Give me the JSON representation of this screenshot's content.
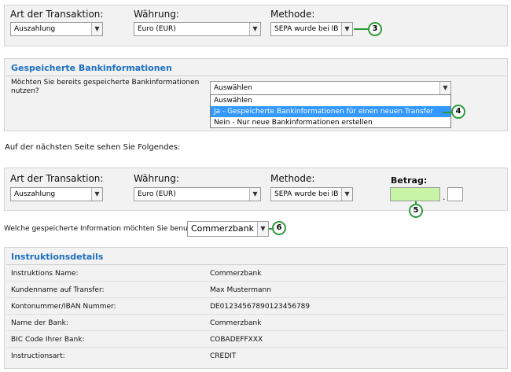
{
  "form1": {
    "type_label": "Art der Transaktion:",
    "type_value": "Auszahlung",
    "currency_label": "Währung:",
    "currency_value": "Euro (EUR)",
    "method_label": "Methode:",
    "method_value": "SEPA wurde bei IB ver",
    "badge": "3"
  },
  "bank_section": {
    "title": "Gespeicherte Bankinformationen",
    "question": "Möchten Sie bereits gespeicherte Bankinformationen nutzen?",
    "select_value": "Auswählen",
    "options": [
      "Auswählen",
      "Ja - Gespeicherte Bankinformationen für einen neuen Transfer nutzen",
      "Nein - Nur neue Bankinformationen erstellen"
    ],
    "badge": "4"
  },
  "next_page_text": "Auf der nächsten Seite sehen Sie Folgendes:",
  "form2": {
    "type_label": "Art der Transaktion:",
    "type_value": "Auszahlung",
    "currency_label": "Währung:",
    "currency_value": "Euro (EUR)",
    "method_label": "Methode:",
    "method_value": "SEPA wurde bei IB ver",
    "amount_label": "Betrag:",
    "amount_sep": ".",
    "badge": "5"
  },
  "saved_info": {
    "question": "Welche gespeicherte Information möchten Sie benutzen?",
    "value": "Commerzbank",
    "badge": "6"
  },
  "details": {
    "title": "Instruktionsdetails",
    "rows": [
      {
        "key": "Instruktions Name:",
        "value": "Commerzbank"
      },
      {
        "key": "Kundenname auf Transfer:",
        "value": "Max Mustermann"
      },
      {
        "key": "Kontonummer/IBAN Nummer:",
        "value": "DE01234567890123456789"
      },
      {
        "key": "Name der Bank:",
        "value": "Commerzbank"
      },
      {
        "key": "BIC Code Ihrer Bank:",
        "value": "COBADEFFXXX"
      },
      {
        "key": "Instructionsart:",
        "value": "CREDIT"
      }
    ]
  },
  "icons": {
    "dropdown": "chevron-down-icon"
  },
  "colors": {
    "accent": "#1d6fc2",
    "badge_border": "#2e9a3a",
    "highlight": "#3399ff",
    "amount_bg": "#c8f5a5"
  }
}
